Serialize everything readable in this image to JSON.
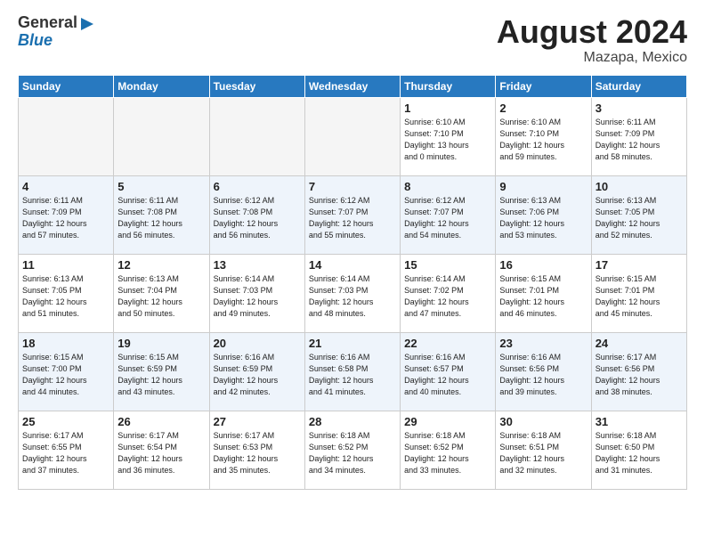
{
  "header": {
    "logo_line1": "General",
    "logo_line2": "Blue",
    "month_year": "August 2024",
    "location": "Mazapa, Mexico"
  },
  "days_of_week": [
    "Sunday",
    "Monday",
    "Tuesday",
    "Wednesday",
    "Thursday",
    "Friday",
    "Saturday"
  ],
  "weeks": [
    [
      {
        "day": "",
        "info": ""
      },
      {
        "day": "",
        "info": ""
      },
      {
        "day": "",
        "info": ""
      },
      {
        "day": "",
        "info": ""
      },
      {
        "day": "1",
        "info": "Sunrise: 6:10 AM\nSunset: 7:10 PM\nDaylight: 13 hours\nand 0 minutes."
      },
      {
        "day": "2",
        "info": "Sunrise: 6:10 AM\nSunset: 7:10 PM\nDaylight: 12 hours\nand 59 minutes."
      },
      {
        "day": "3",
        "info": "Sunrise: 6:11 AM\nSunset: 7:09 PM\nDaylight: 12 hours\nand 58 minutes."
      }
    ],
    [
      {
        "day": "4",
        "info": "Sunrise: 6:11 AM\nSunset: 7:09 PM\nDaylight: 12 hours\nand 57 minutes."
      },
      {
        "day": "5",
        "info": "Sunrise: 6:11 AM\nSunset: 7:08 PM\nDaylight: 12 hours\nand 56 minutes."
      },
      {
        "day": "6",
        "info": "Sunrise: 6:12 AM\nSunset: 7:08 PM\nDaylight: 12 hours\nand 56 minutes."
      },
      {
        "day": "7",
        "info": "Sunrise: 6:12 AM\nSunset: 7:07 PM\nDaylight: 12 hours\nand 55 minutes."
      },
      {
        "day": "8",
        "info": "Sunrise: 6:12 AM\nSunset: 7:07 PM\nDaylight: 12 hours\nand 54 minutes."
      },
      {
        "day": "9",
        "info": "Sunrise: 6:13 AM\nSunset: 7:06 PM\nDaylight: 12 hours\nand 53 minutes."
      },
      {
        "day": "10",
        "info": "Sunrise: 6:13 AM\nSunset: 7:05 PM\nDaylight: 12 hours\nand 52 minutes."
      }
    ],
    [
      {
        "day": "11",
        "info": "Sunrise: 6:13 AM\nSunset: 7:05 PM\nDaylight: 12 hours\nand 51 minutes."
      },
      {
        "day": "12",
        "info": "Sunrise: 6:13 AM\nSunset: 7:04 PM\nDaylight: 12 hours\nand 50 minutes."
      },
      {
        "day": "13",
        "info": "Sunrise: 6:14 AM\nSunset: 7:03 PM\nDaylight: 12 hours\nand 49 minutes."
      },
      {
        "day": "14",
        "info": "Sunrise: 6:14 AM\nSunset: 7:03 PM\nDaylight: 12 hours\nand 48 minutes."
      },
      {
        "day": "15",
        "info": "Sunrise: 6:14 AM\nSunset: 7:02 PM\nDaylight: 12 hours\nand 47 minutes."
      },
      {
        "day": "16",
        "info": "Sunrise: 6:15 AM\nSunset: 7:01 PM\nDaylight: 12 hours\nand 46 minutes."
      },
      {
        "day": "17",
        "info": "Sunrise: 6:15 AM\nSunset: 7:01 PM\nDaylight: 12 hours\nand 45 minutes."
      }
    ],
    [
      {
        "day": "18",
        "info": "Sunrise: 6:15 AM\nSunset: 7:00 PM\nDaylight: 12 hours\nand 44 minutes."
      },
      {
        "day": "19",
        "info": "Sunrise: 6:15 AM\nSunset: 6:59 PM\nDaylight: 12 hours\nand 43 minutes."
      },
      {
        "day": "20",
        "info": "Sunrise: 6:16 AM\nSunset: 6:59 PM\nDaylight: 12 hours\nand 42 minutes."
      },
      {
        "day": "21",
        "info": "Sunrise: 6:16 AM\nSunset: 6:58 PM\nDaylight: 12 hours\nand 41 minutes."
      },
      {
        "day": "22",
        "info": "Sunrise: 6:16 AM\nSunset: 6:57 PM\nDaylight: 12 hours\nand 40 minutes."
      },
      {
        "day": "23",
        "info": "Sunrise: 6:16 AM\nSunset: 6:56 PM\nDaylight: 12 hours\nand 39 minutes."
      },
      {
        "day": "24",
        "info": "Sunrise: 6:17 AM\nSunset: 6:56 PM\nDaylight: 12 hours\nand 38 minutes."
      }
    ],
    [
      {
        "day": "25",
        "info": "Sunrise: 6:17 AM\nSunset: 6:55 PM\nDaylight: 12 hours\nand 37 minutes."
      },
      {
        "day": "26",
        "info": "Sunrise: 6:17 AM\nSunset: 6:54 PM\nDaylight: 12 hours\nand 36 minutes."
      },
      {
        "day": "27",
        "info": "Sunrise: 6:17 AM\nSunset: 6:53 PM\nDaylight: 12 hours\nand 35 minutes."
      },
      {
        "day": "28",
        "info": "Sunrise: 6:18 AM\nSunset: 6:52 PM\nDaylight: 12 hours\nand 34 minutes."
      },
      {
        "day": "29",
        "info": "Sunrise: 6:18 AM\nSunset: 6:52 PM\nDaylight: 12 hours\nand 33 minutes."
      },
      {
        "day": "30",
        "info": "Sunrise: 6:18 AM\nSunset: 6:51 PM\nDaylight: 12 hours\nand 32 minutes."
      },
      {
        "day": "31",
        "info": "Sunrise: 6:18 AM\nSunset: 6:50 PM\nDaylight: 12 hours\nand 31 minutes."
      }
    ]
  ]
}
